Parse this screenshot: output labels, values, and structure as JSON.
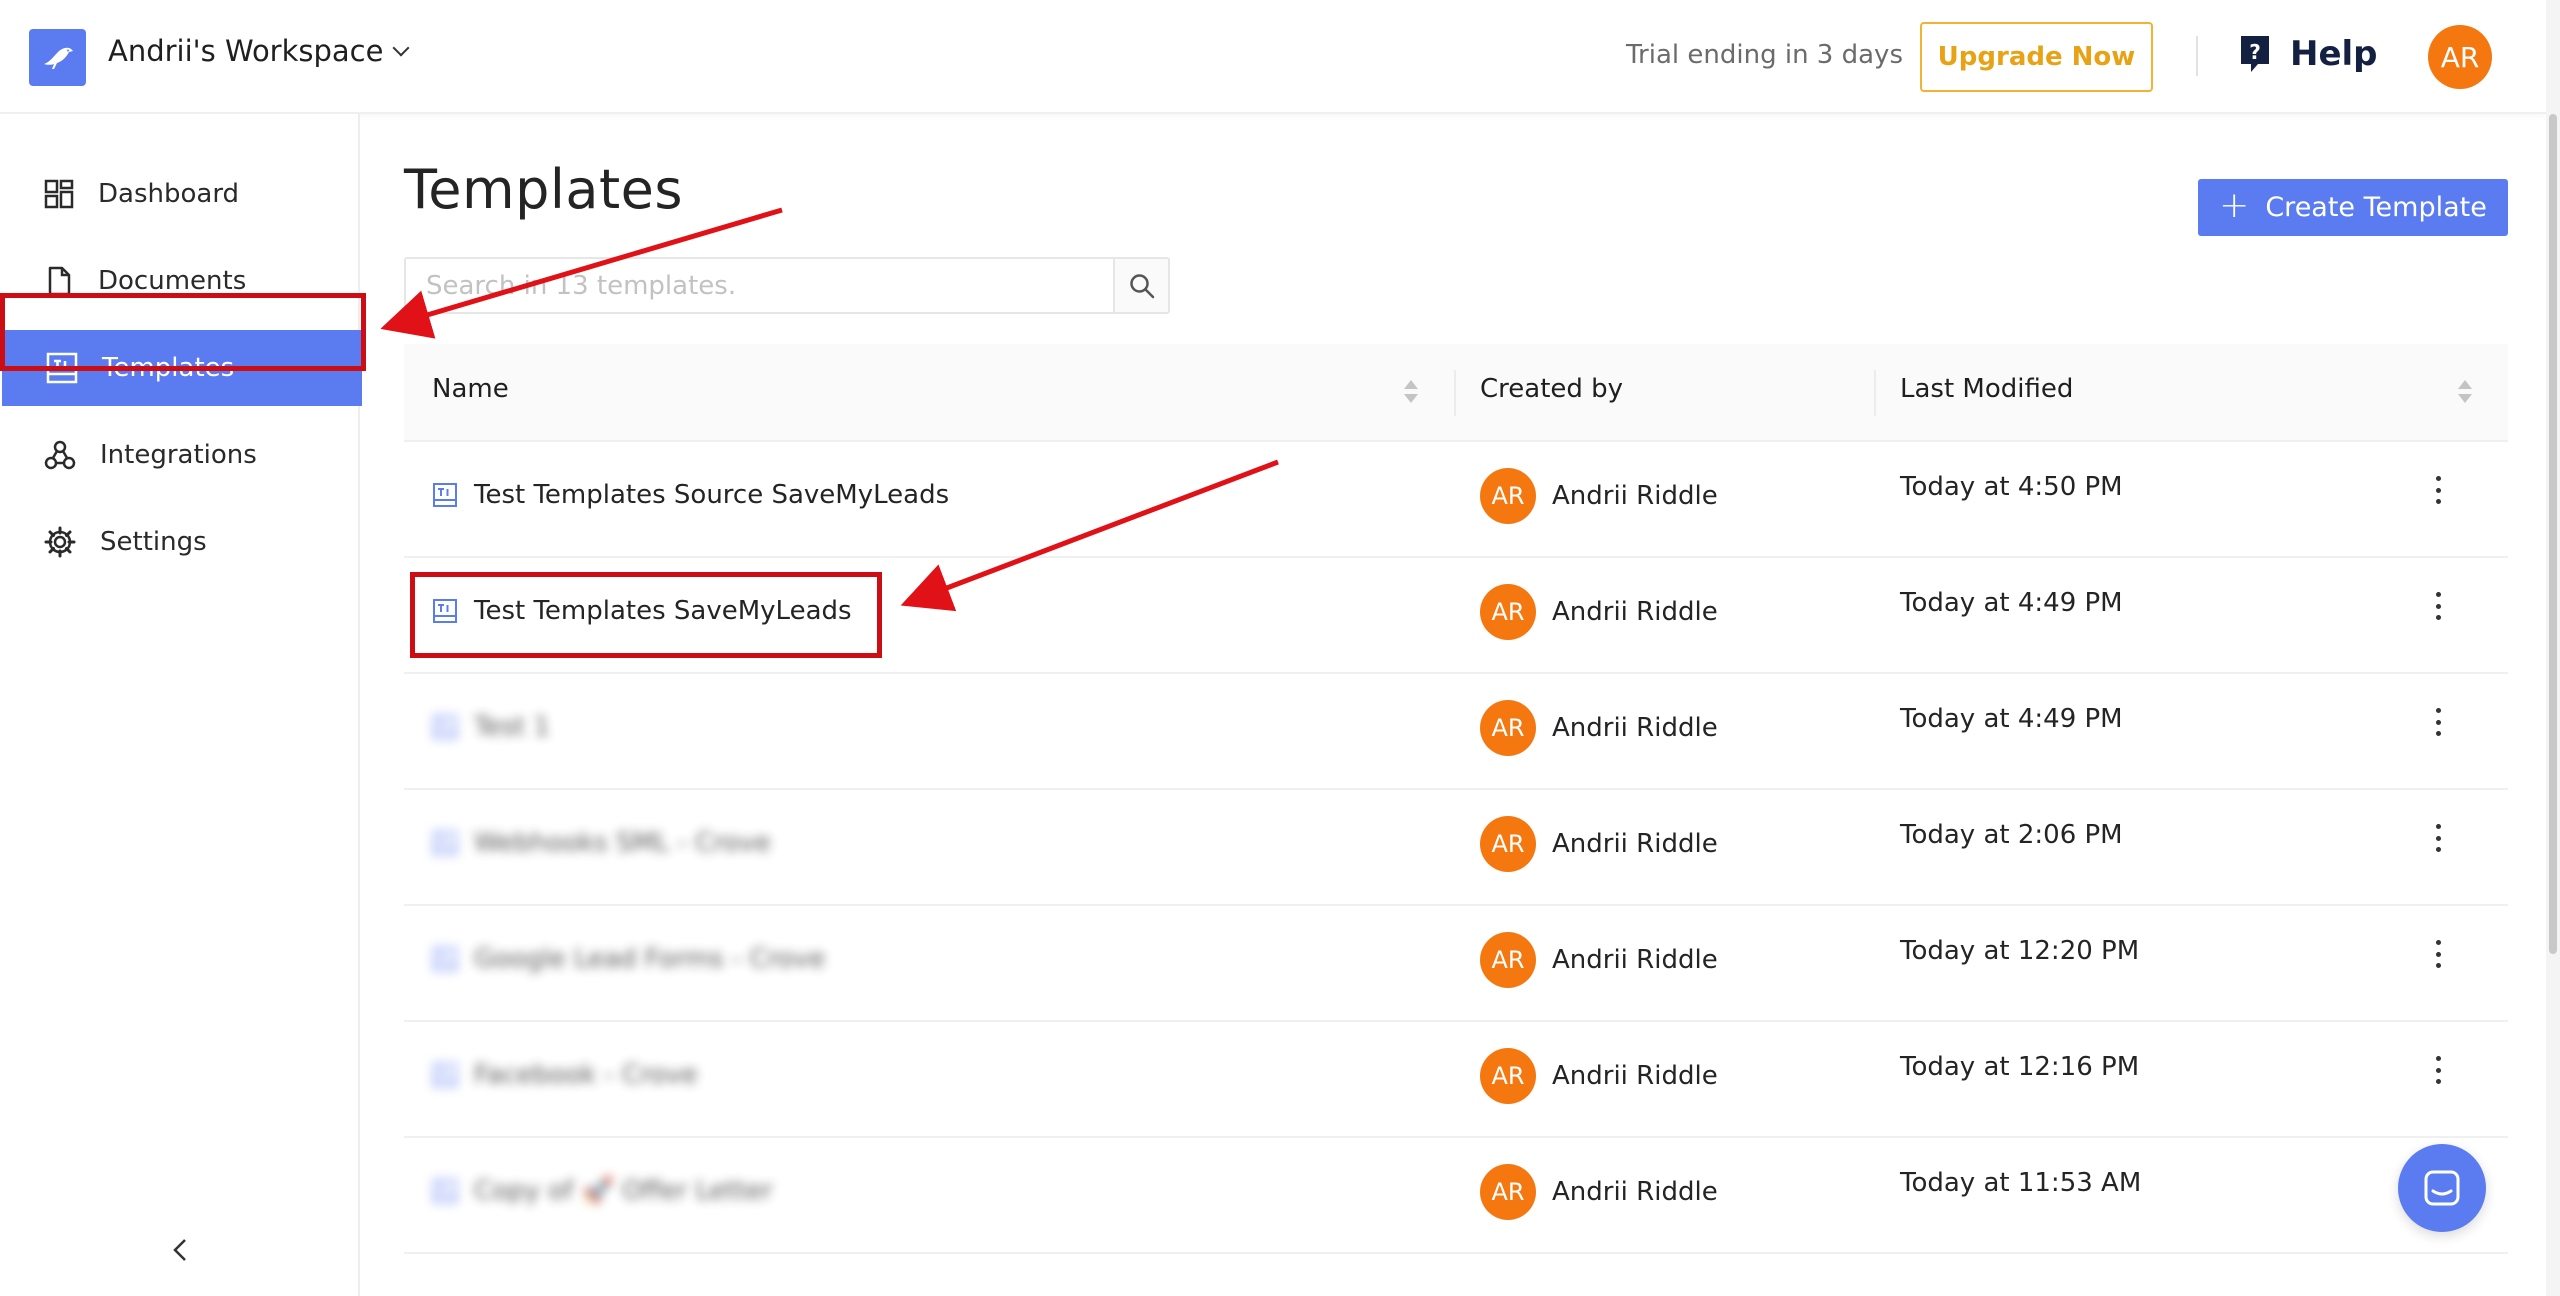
{
  "header": {
    "workspace_name": "Andrii's Workspace",
    "trial_text": "Trial ending in 3 days",
    "upgrade_label": "Upgrade Now",
    "help_label": "Help",
    "user_initials": "AR"
  },
  "sidebar": {
    "items": [
      {
        "label": "Dashboard",
        "icon": "dashboard-icon"
      },
      {
        "label": "Documents",
        "icon": "document-icon"
      },
      {
        "label": "Templates",
        "icon": "template-icon",
        "active": true
      },
      {
        "label": "Integrations",
        "icon": "integrations-icon"
      },
      {
        "label": "Settings",
        "icon": "gear-icon"
      }
    ],
    "collapse_icon": "chevron-left-icon"
  },
  "main": {
    "title": "Templates",
    "create_button_label": "Create Template",
    "search_placeholder": "Search in 13 templates.",
    "table": {
      "columns": [
        "Name",
        "Created by",
        "Last Modified"
      ],
      "rows": [
        {
          "name": "Test Templates Source SaveMyLeads",
          "created_by": "Andrii Riddle",
          "initials": "AR",
          "modified": "Today at 4:50 PM"
        },
        {
          "name": "Test Templates SaveMyLeads",
          "created_by": "Andrii Riddle",
          "initials": "AR",
          "modified": "Today at 4:49 PM"
        },
        {
          "name": "Test 1",
          "created_by": "Andrii Riddle",
          "initials": "AR",
          "modified": "Today at 4:49 PM",
          "blurred": true
        },
        {
          "name": "Webhooks SML - Crove",
          "created_by": "Andrii Riddle",
          "initials": "AR",
          "modified": "Today at 2:06 PM",
          "blurred": true
        },
        {
          "name": "Google Lead Forms - Crove",
          "created_by": "Andrii Riddle",
          "initials": "AR",
          "modified": "Today at 12:20 PM",
          "blurred": true
        },
        {
          "name": "Facebook - Crove",
          "created_by": "Andrii Riddle",
          "initials": "AR",
          "modified": "Today at 12:16 PM",
          "blurred": true
        },
        {
          "name": "Copy of 🚀 Offer Letter",
          "created_by": "Andrii Riddle",
          "initials": "AR",
          "modified": "Today at 11:53 AM",
          "blurred": true
        }
      ]
    }
  },
  "colors": {
    "accent": "#5b7cf0",
    "avatar": "#f4770f",
    "upgrade": "#f3b231",
    "annotation": "#cc0e14"
  }
}
